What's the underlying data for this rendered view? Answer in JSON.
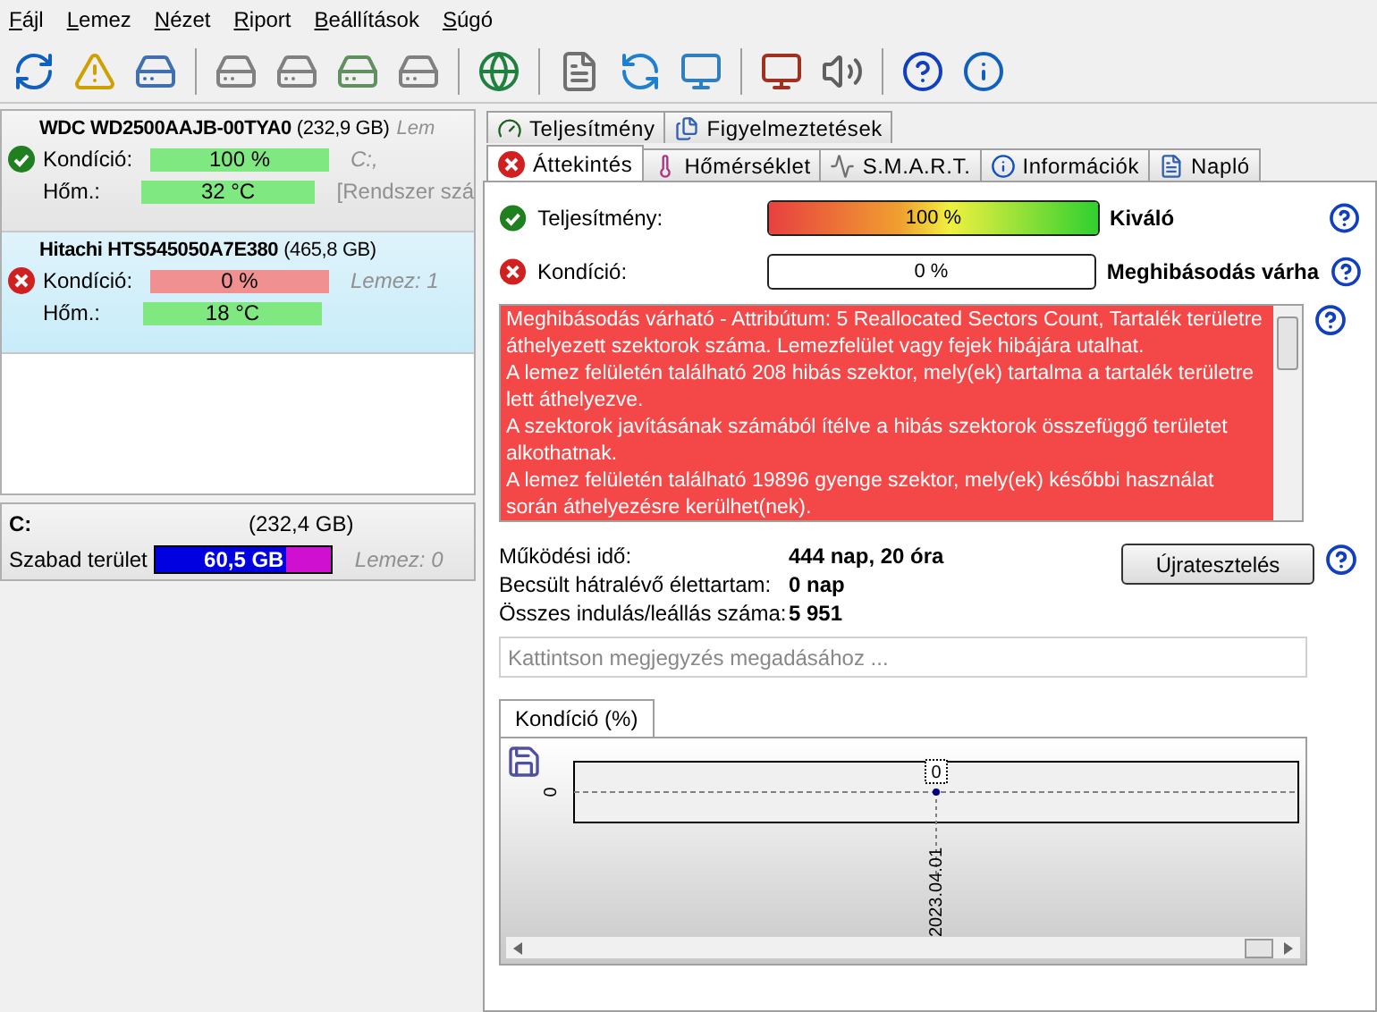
{
  "menu": [
    "Fájl",
    "Lemez",
    "Nézet",
    "Riport",
    "Beállítások",
    "Súgó"
  ],
  "disks": [
    {
      "name": "WDC WD2500AAJB-00TYA0",
      "size": "(232,9 GB)",
      "note": "Lem",
      "failed": false,
      "selected": false,
      "condition_label": "Kondíció:",
      "condition": "100 %",
      "temperature_label": "Hőm.:",
      "temperature": "32 °C",
      "side_1": "C:,",
      "side_2": "[Rendszer szá"
    },
    {
      "name": "Hitachi HTS545050A7E380",
      "size": "(465,8 GB)",
      "failed": true,
      "selected": true,
      "condition_label": "Kondíció:",
      "condition": "0 %",
      "temperature_label": "Hőm.:",
      "temperature": "18 °C",
      "side_1": "Lemez: 1"
    }
  ],
  "partition": {
    "name": "C:",
    "size": "(232,4 GB)",
    "label": "Szabad terület",
    "free": "60,5 GB",
    "level": 0.74,
    "disk": "Lemez: 0"
  },
  "top_tabs": [
    {
      "label": "Teljesítmény",
      "selected": false,
      "kind": "gauge"
    },
    {
      "label": "Figyelmeztetések",
      "selected": false,
      "kind": "pages"
    }
  ],
  "tabs": [
    {
      "label": "Áttekintés",
      "selected": true,
      "kind": "error"
    },
    {
      "label": "Hőmérséklet",
      "selected": false,
      "kind": "thermo"
    },
    {
      "label": "S.M.A.R.T.",
      "selected": false,
      "kind": "smart"
    },
    {
      "label": "Információk",
      "selected": false,
      "kind": "info"
    },
    {
      "label": "Napló",
      "selected": false,
      "kind": "log"
    }
  ],
  "metrics": [
    {
      "label": "Teljesítmény:",
      "failed": false,
      "level": 1,
      "reading": "100 %",
      "verdict": "Kiváló"
    },
    {
      "label": "Kondíció:",
      "failed": true,
      "level": 0,
      "reading": "0 %",
      "verdict": "Meghibásodás várha"
    }
  ],
  "messages": [
    "Meghibásodás várható - Attribútum: 5 Reallocated Sectors Count, Tartalék területre áthelyezett szektorok száma. Lemezfelület vagy fejek hibájára utalhat.",
    "A lemez felületén található 208 hibás szektor, mely(ek) tartalma a tartalék területre lett áthelyezve.",
    "A szektorok javításának számából ítélve a hibás szektorok összefüggő területet alkothatnak.",
    "A lemez felületén található 19896 gyenge szektor, mely(ek) későbbi használat során áthelyezésre kerülhet(nek)."
  ],
  "stats": [
    {
      "label": "Működési idő:",
      "value": "444 nap, 20 óra"
    },
    {
      "label": "Becsült hátralévő élettartam:",
      "value": "0 nap"
    },
    {
      "label": "Összes indulás/leállás száma:",
      "value": "5 951"
    }
  ],
  "retest_button": "Újratesztelés",
  "note_field": {
    "placeholder": "Kattintson megjegyzés megadásához ..."
  },
  "chart": {
    "tab": "Kondíció  (%)",
    "y_tick": "0",
    "points": [
      {
        "label": "0",
        "date": "2023.04.01"
      }
    ]
  }
}
